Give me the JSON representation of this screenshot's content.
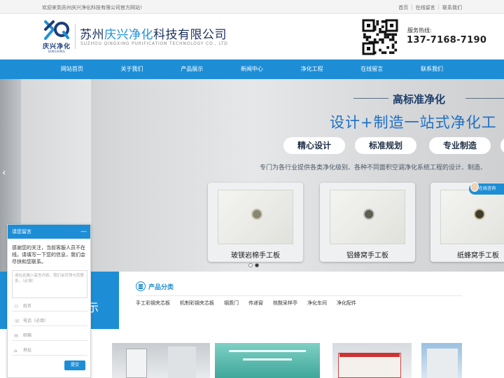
{
  "topbar": {
    "welcome": "欢迎来到苏州庆兴净化科技有限公司官方网站!",
    "links": [
      "首页",
      "在线留言",
      "联系我们"
    ]
  },
  "header": {
    "logo_brand": "庆兴净化",
    "logo_sub": "QINGXING",
    "company_name_prefix": "苏州",
    "company_name_highlight": "庆兴净化",
    "company_name_suffix": "科技有限公司",
    "company_name_en": "SUZHOU QINGXING PURIFICATION TECHNOLOGY CO., LTD",
    "hotline_label": "服务热线:",
    "hotline_number": "137-7168-7190"
  },
  "nav": {
    "items": [
      "网站首页",
      "关于我们",
      "产品展示",
      "新闻中心",
      "净化工程",
      "在线留言",
      "联系我们"
    ]
  },
  "banner": {
    "title": "高标准净化",
    "subtitle": "设计+制造一站式净化工",
    "tags": [
      "精心设计",
      "标准规划",
      "专业制造"
    ],
    "description": "专门为各行业提供各类净化级别、各种不同面积空调净化系统工程的设计、制造、",
    "products": [
      "玻镁岩棉手工板",
      "铝蜂窝手工板",
      "纸蜂窝手工板"
    ],
    "online_button": "在线咨询"
  },
  "category": {
    "left_label": "示",
    "heading": "产品分类",
    "items": [
      "手工彩钢夹芯板",
      "机制彩钢夹芯板",
      "钢质门",
      "传递窗",
      "核酸采样亭",
      "净化车间",
      "净化配件"
    ]
  },
  "chat": {
    "title": "请您留言",
    "close": "—",
    "intro": "感谢您的关注，当前客服人员不在线，请填写一下您的信息，我们会尽快和您联系。",
    "message_placeholder": "请在此输入留言内容，我们会尽快与您联系。（必填）",
    "fields": [
      "姓名",
      "电话（必填）",
      "邮箱",
      "地址"
    ],
    "submit": "提交"
  },
  "colors": {
    "primary": "#1d8ed6",
    "navy": "#1b2f5e"
  }
}
